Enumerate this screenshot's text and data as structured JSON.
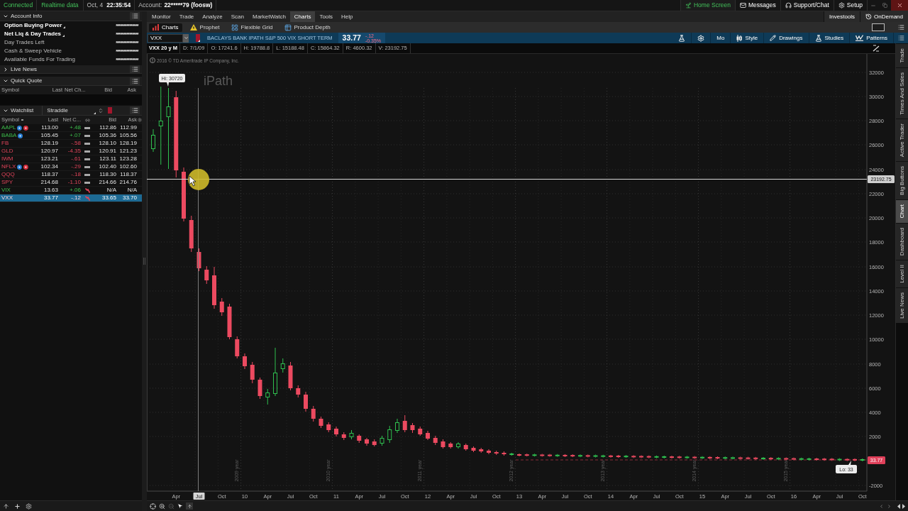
{
  "status_bar": {
    "connection": "Connected",
    "data_feed": "Realtime data",
    "date": "Oct, 4",
    "time": "22:35:54",
    "account_label": "Account:",
    "account_id": "22*****79 (foosw)"
  },
  "top_links": [
    {
      "label": "Home Screen",
      "selected": true
    },
    {
      "label": "Messages",
      "selected": false
    },
    {
      "label": "Support/Chat",
      "selected": false
    },
    {
      "label": "Setup",
      "selected": false
    }
  ],
  "account_info": {
    "title": "Account Info",
    "expanded": true,
    "rows": [
      {
        "label": "Option Buying Power",
        "value": "***************",
        "emphasized": true
      },
      {
        "label": "Net Liq & Day Trades",
        "value": "***************",
        "emphasized": true
      },
      {
        "label": "Day Trades Left",
        "value": "***************",
        "emphasized": false
      },
      {
        "label": "Cash & Sweep Vehicle",
        "value": "***************",
        "emphasized": false
      },
      {
        "label": "Available Funds For Trading",
        "value": "***************",
        "emphasized": false
      }
    ]
  },
  "live_news": {
    "title": "Live News",
    "expanded": false
  },
  "quick_quote": {
    "title": "Quick Quote",
    "expanded": true,
    "columns": [
      "Symbol",
      "Last",
      "Net Ch...",
      "Bid",
      "Ask"
    ]
  },
  "watchlist": {
    "title": "Watchlist",
    "expanded": true,
    "list_name": "Straddle",
    "columns": [
      "Symbol",
      "Last",
      "Net C...",
      "Bid",
      "Ask"
    ],
    "rows": [
      {
        "symbol": "AAPL",
        "last": "113.00",
        "net_change": "+.48",
        "bid": "112.86",
        "ask": "112.99",
        "rising": true,
        "spark_falling": false,
        "selected": false,
        "markers": [
          {
            "color": "#2a7fd4"
          },
          {
            "color": "#d6303f"
          }
        ]
      },
      {
        "symbol": "BABA",
        "last": "105.45",
        "net_change": "+.07",
        "bid": "105.36",
        "ask": "105.56",
        "rising": true,
        "spark_falling": false,
        "selected": false,
        "markers": [
          {
            "color": "#2a7fd4"
          }
        ]
      },
      {
        "symbol": "FB",
        "last": "128.19",
        "net_change": "-.58",
        "bid": "128.10",
        "ask": "128.19",
        "rising": false,
        "spark_falling": false,
        "selected": false
      },
      {
        "symbol": "GLD",
        "last": "120.97",
        "net_change": "-4.35",
        "bid": "120.91",
        "ask": "121.23",
        "rising": false,
        "spark_falling": false,
        "selected": false
      },
      {
        "symbol": "IWM",
        "last": "123.21",
        "net_change": "-.61",
        "bid": "123.11",
        "ask": "123.28",
        "rising": false,
        "spark_falling": false,
        "selected": false
      },
      {
        "symbol": "NFLX",
        "last": "102.34",
        "net_change": "-.29",
        "bid": "102.40",
        "ask": "102.60",
        "rising": false,
        "spark_falling": false,
        "selected": false,
        "markers": [
          {
            "color": "#2a7fd4"
          },
          {
            "color": "#d6303f"
          }
        ]
      },
      {
        "symbol": "QQQ",
        "last": "118.37",
        "net_change": "-.18",
        "bid": "118.30",
        "ask": "118.37",
        "rising": false,
        "spark_falling": false,
        "selected": false
      },
      {
        "symbol": "SPY",
        "last": "214.68",
        "net_change": "-1.10",
        "bid": "214.66",
        "ask": "214.76",
        "rising": false,
        "spark_falling": false,
        "selected": false
      },
      {
        "symbol": "VIX",
        "last": "13.63",
        "net_change": "+.06",
        "bid": "N/A",
        "ask": "N/A",
        "rising": true,
        "spark_falling": true,
        "selected": false
      },
      {
        "symbol": "VXX",
        "last": "33.77",
        "net_change": "-.12",
        "bid": "33.65",
        "ask": "33.70",
        "rising": false,
        "spark_falling": true,
        "selected": true
      }
    ]
  },
  "menu_tabs": [
    {
      "label": "Monitor",
      "selected": false
    },
    {
      "label": "Trade",
      "selected": false
    },
    {
      "label": "Analyze",
      "selected": false
    },
    {
      "label": "Scan",
      "selected": false
    },
    {
      "label": "MarketWatch",
      "selected": false
    },
    {
      "label": "Charts",
      "selected": true
    },
    {
      "label": "Tools",
      "selected": false
    },
    {
      "label": "Help",
      "selected": false
    }
  ],
  "menu_links": [
    "Investools",
    "OnDemand"
  ],
  "sub_tabs": [
    {
      "label": "Charts",
      "selected": true
    },
    {
      "label": "Prophet",
      "selected": false
    },
    {
      "label": "Flexible Grid",
      "selected": false
    },
    {
      "label": "Product Depth",
      "selected": false
    }
  ],
  "symbol_bar": {
    "symbol": "VXX",
    "description": "BACLAYS BANK IPATH S&P 500 VIX SHORT TERM",
    "last": "33.77",
    "change": "-.12",
    "change_percent": "-0.35%",
    "tools": [
      "Mo",
      "Style",
      "Drawings",
      "Studies",
      "Patterns"
    ]
  },
  "chart_info": {
    "setting": "VXX 20 y M",
    "fields": [
      "D: 7/1/09",
      "O: 17241.6",
      "H: 19788.8",
      "L: 15188.48",
      "C: 15864.32",
      "R: 4600.32",
      "V: 23192.75"
    ]
  },
  "chart": {
    "copyright": "2016 © TD Ameritrade IP Company, Inc.",
    "logo": "iPath",
    "high_label": "Hi: 30720",
    "low_label": "Lo: 33",
    "crosshair_price": "23192.75",
    "last_price": "33.77",
    "y_ticks": [
      "32000",
      "30000",
      "28000",
      "26000",
      "24000",
      "22000",
      "20000",
      "18000",
      "16000",
      "14000",
      "12000",
      "10000",
      "8000",
      "6000",
      "4000",
      "2000",
      "-2000"
    ],
    "x_ticks": [
      {
        "label": "Apr",
        "highlighted": false
      },
      {
        "label": "Jul",
        "highlighted": true
      },
      {
        "label": "Oct",
        "highlighted": false
      },
      {
        "label": "10",
        "highlighted": false
      },
      {
        "label": "Apr",
        "highlighted": false
      },
      {
        "label": "Jul",
        "highlighted": false
      },
      {
        "label": "Oct",
        "highlighted": false
      },
      {
        "label": "11",
        "highlighted": false
      },
      {
        "label": "Apr",
        "highlighted": false
      },
      {
        "label": "Jul",
        "highlighted": false
      },
      {
        "label": "Oct",
        "highlighted": false
      },
      {
        "label": "12",
        "highlighted": false
      },
      {
        "label": "Apr",
        "highlighted": false
      },
      {
        "label": "Jul",
        "highlighted": false
      },
      {
        "label": "Oct",
        "highlighted": false
      },
      {
        "label": "13",
        "highlighted": false
      },
      {
        "label": "Apr",
        "highlighted": false
      },
      {
        "label": "Jul",
        "highlighted": false
      },
      {
        "label": "Oct",
        "highlighted": false
      },
      {
        "label": "14",
        "highlighted": false
      },
      {
        "label": "Apr",
        "highlighted": false
      },
      {
        "label": "Jul",
        "highlighted": false
      },
      {
        "label": "Oct",
        "highlighted": false
      },
      {
        "label": "15",
        "highlighted": false
      },
      {
        "label": "Apr",
        "highlighted": false
      },
      {
        "label": "Jul",
        "highlighted": false
      },
      {
        "label": "Oct",
        "highlighted": false
      },
      {
        "label": "16",
        "highlighted": false
      },
      {
        "label": "Apr",
        "highlighted": false
      },
      {
        "label": "Jul",
        "highlighted": false
      },
      {
        "label": "Oct",
        "highlighted": false
      }
    ],
    "year_labels": [
      "2009 year",
      "2010 year",
      "2011 year",
      "2012 year",
      "2013 year",
      "2014 year",
      "2015 year"
    ]
  },
  "side_tabs": [
    {
      "label": "Trade",
      "selected": false
    },
    {
      "label": "Times And Sales",
      "selected": false
    },
    {
      "label": "Active Trader",
      "selected": false
    },
    {
      "label": "Big Buttons",
      "selected": false
    },
    {
      "label": "Chart",
      "selected": true
    },
    {
      "label": "Dashboard",
      "selected": false
    },
    {
      "label": "Level II",
      "selected": false
    },
    {
      "label": "Live News",
      "selected": false
    }
  ]
}
